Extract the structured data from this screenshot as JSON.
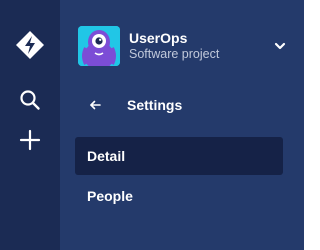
{
  "colors": {
    "rail_bg": "#1b2b54",
    "sidebar_bg": "#243a6b",
    "selected_bg": "#152247",
    "avatar_bg": "#21c6e6",
    "text_primary": "#ffffff",
    "text_secondary": "#c1c9db"
  },
  "rail": {
    "items": [
      {
        "icon": "diamond-logo-icon"
      },
      {
        "icon": "search-icon"
      },
      {
        "icon": "plus-icon"
      }
    ]
  },
  "project": {
    "name": "UserOps",
    "type": "Software project",
    "avatar_icon": "monster-avatar-icon",
    "chevron_icon": "chevron-down-icon"
  },
  "back": {
    "icon": "arrow-left-icon",
    "label": "Settings"
  },
  "nav": {
    "items": [
      {
        "label": "Detail",
        "selected": true
      },
      {
        "label": "People",
        "selected": false
      }
    ]
  }
}
